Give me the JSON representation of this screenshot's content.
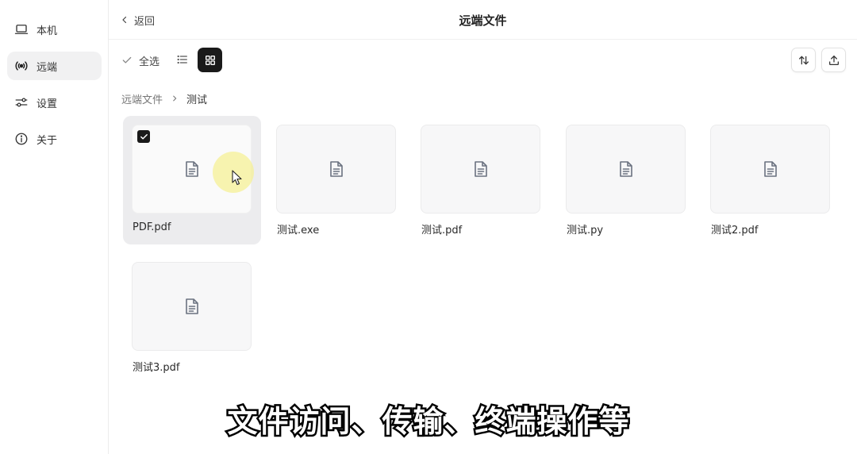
{
  "sidebar": {
    "items": [
      {
        "label": "本机",
        "icon": "laptop-icon",
        "active": false
      },
      {
        "label": "远端",
        "icon": "broadcast-icon",
        "active": true
      },
      {
        "label": "设置",
        "icon": "sliders-icon",
        "active": false
      },
      {
        "label": "关于",
        "icon": "info-icon",
        "active": false
      }
    ]
  },
  "header": {
    "back_label": "返回",
    "title": "远端文件"
  },
  "toolbar": {
    "select_all_label": "全选",
    "view_mode": "grid"
  },
  "breadcrumb": {
    "root": "远端文件",
    "current": "测试"
  },
  "files": [
    {
      "name": "PDF.pdf",
      "selected": true
    },
    {
      "name": "测试.exe",
      "selected": false
    },
    {
      "name": "测试.pdf",
      "selected": false
    },
    {
      "name": "测试.py",
      "selected": false
    },
    {
      "name": "测试2.pdf",
      "selected": false
    },
    {
      "name": "测试3.pdf",
      "selected": false
    }
  ],
  "subtitle": "文件访问、传输、终端操作等",
  "colors": {
    "accent_dark": "#1a1a1a",
    "sidebar_active_bg": "#f1f1f2",
    "selected_card_bg": "#ececee",
    "cursor_highlight": "#f6f096"
  }
}
